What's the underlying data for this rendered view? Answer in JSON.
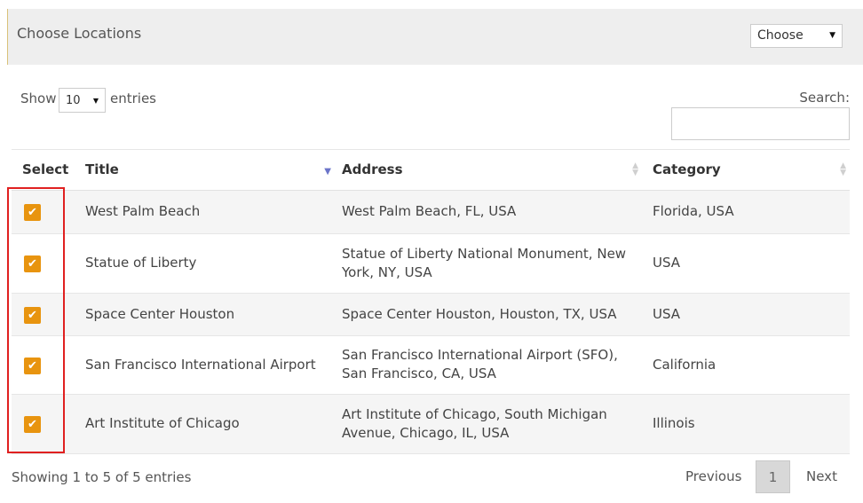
{
  "header": {
    "title": "Choose Locations",
    "choose_select": {
      "value": "Choose",
      "caret": "▼"
    }
  },
  "length_control": {
    "show_label": "Show",
    "value": "10",
    "caret": "▼",
    "entries_label": "entries"
  },
  "search": {
    "label": "Search:",
    "value": ""
  },
  "table": {
    "columns": [
      {
        "label": "Select"
      },
      {
        "label": "Title",
        "sort": "descending"
      },
      {
        "label": "Address",
        "sort": "both"
      },
      {
        "label": "Category",
        "sort": "both"
      }
    ],
    "rows": [
      {
        "checked": true,
        "title": "West Palm Beach",
        "address": "West Palm Beach, FL, USA",
        "category": "Florida, USA"
      },
      {
        "checked": true,
        "title": "Statue of Liberty",
        "address": "Statue of Liberty National Monument, New York, NY, USA",
        "category": "USA"
      },
      {
        "checked": true,
        "title": "Space Center Houston",
        "address": "Space Center Houston, Houston, TX, USA",
        "category": "USA"
      },
      {
        "checked": true,
        "title": "San Francisco International Airport",
        "address": "San Francisco International Airport (SFO), San Francisco, CA, USA",
        "category": "California"
      },
      {
        "checked": true,
        "title": "Art Institute of Chicago",
        "address": "Art Institute of Chicago, South Michigan Avenue, Chicago, IL, USA",
        "category": "Illinois"
      }
    ]
  },
  "footer": {
    "info": "Showing 1 to 5 of 5 entries",
    "previous_label": "Previous",
    "current_page": "1",
    "next_label": "Next"
  },
  "colors": {
    "checkbox": "#e8940f",
    "highlight": "#e02020",
    "sort_active": "#6b74c9"
  },
  "icons": {
    "checkbox_check": "✔",
    "sort_both": "▲▼",
    "sort_desc": "▼"
  }
}
